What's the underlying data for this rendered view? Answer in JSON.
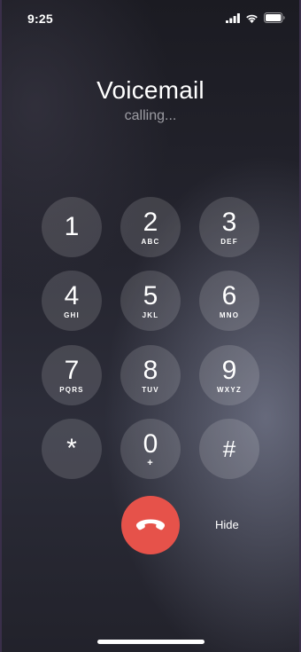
{
  "status_bar": {
    "time": "9:25",
    "icons": [
      "signal-icon",
      "wifi-icon",
      "battery-icon"
    ]
  },
  "call": {
    "title": "Voicemail",
    "status": "calling..."
  },
  "keypad": {
    "keys": [
      {
        "digit": "1",
        "letters": ""
      },
      {
        "digit": "2",
        "letters": "ABC"
      },
      {
        "digit": "3",
        "letters": "DEF"
      },
      {
        "digit": "4",
        "letters": "GHI"
      },
      {
        "digit": "5",
        "letters": "JKL"
      },
      {
        "digit": "6",
        "letters": "MNO"
      },
      {
        "digit": "7",
        "letters": "PQRS"
      },
      {
        "digit": "8",
        "letters": "TUV"
      },
      {
        "digit": "9",
        "letters": "WXYZ"
      },
      {
        "digit": "*",
        "letters": ""
      },
      {
        "digit": "0",
        "letters": "+"
      },
      {
        "digit": "#",
        "letters": ""
      }
    ]
  },
  "controls": {
    "end_call_icon": "phone-hangup-icon",
    "end_call_color": "#e6524a",
    "hide_label": "Hide"
  }
}
